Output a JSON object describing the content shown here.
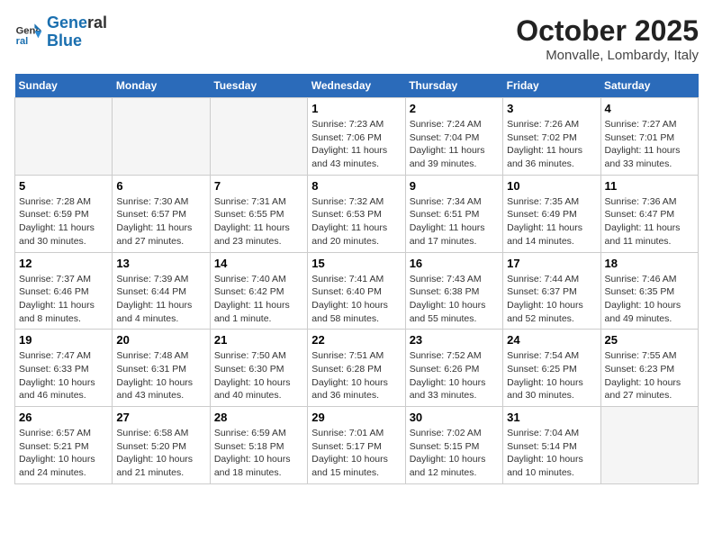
{
  "header": {
    "logo_line1": "General",
    "logo_line2": "Blue",
    "month": "October 2025",
    "location": "Monvalle, Lombardy, Italy"
  },
  "weekdays": [
    "Sunday",
    "Monday",
    "Tuesday",
    "Wednesday",
    "Thursday",
    "Friday",
    "Saturday"
  ],
  "weeks": [
    [
      {
        "day": "",
        "info": ""
      },
      {
        "day": "",
        "info": ""
      },
      {
        "day": "",
        "info": ""
      },
      {
        "day": "1",
        "info": "Sunrise: 7:23 AM\nSunset: 7:06 PM\nDaylight: 11 hours and 43 minutes."
      },
      {
        "day": "2",
        "info": "Sunrise: 7:24 AM\nSunset: 7:04 PM\nDaylight: 11 hours and 39 minutes."
      },
      {
        "day": "3",
        "info": "Sunrise: 7:26 AM\nSunset: 7:02 PM\nDaylight: 11 hours and 36 minutes."
      },
      {
        "day": "4",
        "info": "Sunrise: 7:27 AM\nSunset: 7:01 PM\nDaylight: 11 hours and 33 minutes."
      }
    ],
    [
      {
        "day": "5",
        "info": "Sunrise: 7:28 AM\nSunset: 6:59 PM\nDaylight: 11 hours and 30 minutes."
      },
      {
        "day": "6",
        "info": "Sunrise: 7:30 AM\nSunset: 6:57 PM\nDaylight: 11 hours and 27 minutes."
      },
      {
        "day": "7",
        "info": "Sunrise: 7:31 AM\nSunset: 6:55 PM\nDaylight: 11 hours and 23 minutes."
      },
      {
        "day": "8",
        "info": "Sunrise: 7:32 AM\nSunset: 6:53 PM\nDaylight: 11 hours and 20 minutes."
      },
      {
        "day": "9",
        "info": "Sunrise: 7:34 AM\nSunset: 6:51 PM\nDaylight: 11 hours and 17 minutes."
      },
      {
        "day": "10",
        "info": "Sunrise: 7:35 AM\nSunset: 6:49 PM\nDaylight: 11 hours and 14 minutes."
      },
      {
        "day": "11",
        "info": "Sunrise: 7:36 AM\nSunset: 6:47 PM\nDaylight: 11 hours and 11 minutes."
      }
    ],
    [
      {
        "day": "12",
        "info": "Sunrise: 7:37 AM\nSunset: 6:46 PM\nDaylight: 11 hours and 8 minutes."
      },
      {
        "day": "13",
        "info": "Sunrise: 7:39 AM\nSunset: 6:44 PM\nDaylight: 11 hours and 4 minutes."
      },
      {
        "day": "14",
        "info": "Sunrise: 7:40 AM\nSunset: 6:42 PM\nDaylight: 11 hours and 1 minute."
      },
      {
        "day": "15",
        "info": "Sunrise: 7:41 AM\nSunset: 6:40 PM\nDaylight: 10 hours and 58 minutes."
      },
      {
        "day": "16",
        "info": "Sunrise: 7:43 AM\nSunset: 6:38 PM\nDaylight: 10 hours and 55 minutes."
      },
      {
        "day": "17",
        "info": "Sunrise: 7:44 AM\nSunset: 6:37 PM\nDaylight: 10 hours and 52 minutes."
      },
      {
        "day": "18",
        "info": "Sunrise: 7:46 AM\nSunset: 6:35 PM\nDaylight: 10 hours and 49 minutes."
      }
    ],
    [
      {
        "day": "19",
        "info": "Sunrise: 7:47 AM\nSunset: 6:33 PM\nDaylight: 10 hours and 46 minutes."
      },
      {
        "day": "20",
        "info": "Sunrise: 7:48 AM\nSunset: 6:31 PM\nDaylight: 10 hours and 43 minutes."
      },
      {
        "day": "21",
        "info": "Sunrise: 7:50 AM\nSunset: 6:30 PM\nDaylight: 10 hours and 40 minutes."
      },
      {
        "day": "22",
        "info": "Sunrise: 7:51 AM\nSunset: 6:28 PM\nDaylight: 10 hours and 36 minutes."
      },
      {
        "day": "23",
        "info": "Sunrise: 7:52 AM\nSunset: 6:26 PM\nDaylight: 10 hours and 33 minutes."
      },
      {
        "day": "24",
        "info": "Sunrise: 7:54 AM\nSunset: 6:25 PM\nDaylight: 10 hours and 30 minutes."
      },
      {
        "day": "25",
        "info": "Sunrise: 7:55 AM\nSunset: 6:23 PM\nDaylight: 10 hours and 27 minutes."
      }
    ],
    [
      {
        "day": "26",
        "info": "Sunrise: 6:57 AM\nSunset: 5:21 PM\nDaylight: 10 hours and 24 minutes."
      },
      {
        "day": "27",
        "info": "Sunrise: 6:58 AM\nSunset: 5:20 PM\nDaylight: 10 hours and 21 minutes."
      },
      {
        "day": "28",
        "info": "Sunrise: 6:59 AM\nSunset: 5:18 PM\nDaylight: 10 hours and 18 minutes."
      },
      {
        "day": "29",
        "info": "Sunrise: 7:01 AM\nSunset: 5:17 PM\nDaylight: 10 hours and 15 minutes."
      },
      {
        "day": "30",
        "info": "Sunrise: 7:02 AM\nSunset: 5:15 PM\nDaylight: 10 hours and 12 minutes."
      },
      {
        "day": "31",
        "info": "Sunrise: 7:04 AM\nSunset: 5:14 PM\nDaylight: 10 hours and 10 minutes."
      },
      {
        "day": "",
        "info": ""
      }
    ]
  ]
}
